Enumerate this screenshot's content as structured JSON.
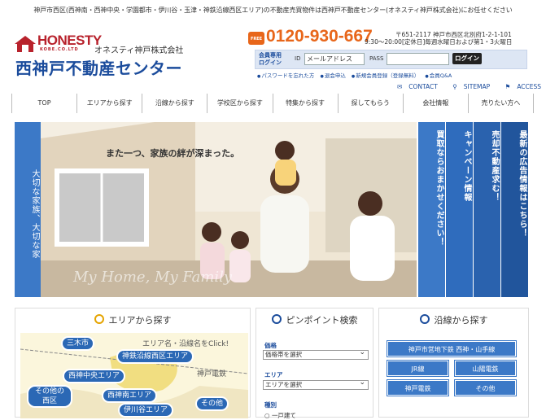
{
  "topbar": "神戸市西区(西神南・西神中央・学園都市・伊川谷・玉津・神鉄沿線西区エリア)の不動産売買物件は西神戸不動産センター(オネスティ神戸株式会社)にお任せください",
  "logo": {
    "brand": "HONESTY",
    "brand_sub": "KOBE.CO.LTD",
    "company_small": "オネスティ神戸株式会社",
    "company_big": "西神戸不動産センター"
  },
  "contact": {
    "free_badge": "FREE",
    "phone": "0120-930-667",
    "hours": "9:30〜20:00[定休日]毎週水曜日および第1・3火曜日",
    "address": "〒651-2117 神戸市西区北別府1-2-1-101"
  },
  "login": {
    "title": "会員専用\nログイン",
    "id_label": "ID",
    "id_placeholder": "メールアドレス",
    "pass_label": "PASS",
    "button": "ログイン",
    "links": [
      "パスワードを忘れた方",
      "退会申込",
      "新規会員登録（登録無料）",
      "会員Q&A"
    ]
  },
  "utility": [
    "CONTACT",
    "SITEMAP",
    "ACCESS"
  ],
  "nav": [
    "TOP",
    "エリアから探す",
    "沿線から探す",
    "学校区から探す",
    "特集から探す",
    "探してもらう",
    "会社情報",
    "売りたい方へ"
  ],
  "hero": {
    "left_text": "大切な家族、大切な家",
    "tagline": "また一つ、家族の絆が深まった。",
    "script": "My Home, My Family",
    "tabs": [
      "買取ならおまかせください！",
      "キャンペーン情報",
      "売却不動産求む！",
      "最新の広告情報はこちら！"
    ],
    "tab_colors": [
      "#3c79c7",
      "#2f6cbd",
      "#2a62ae",
      "#21559c"
    ]
  },
  "area_panel": {
    "title": "エリアから探す",
    "note": "エリア名・沿線名をClick!",
    "areas": [
      "三木市",
      "神鉄沿線西区エリア",
      "西神中央エリア",
      "神戸電鉄",
      "その他の西区",
      "西神南エリア",
      "伊川谷エリア",
      "その他"
    ]
  },
  "pinpoint": {
    "title": "ピンポイント検索",
    "price_label": "価格",
    "price_value": "価格帯を選択",
    "area_label": "エリア",
    "area_value": "エリアを選択",
    "type_label": "種別",
    "type_option": "一戸建て"
  },
  "line_panel": {
    "title": "沿線から探す",
    "buttons": [
      "神戸市営地下鉄 西神・山手線",
      "JR線",
      "山陽電鉄",
      "神戸電鉄",
      "その他"
    ]
  }
}
